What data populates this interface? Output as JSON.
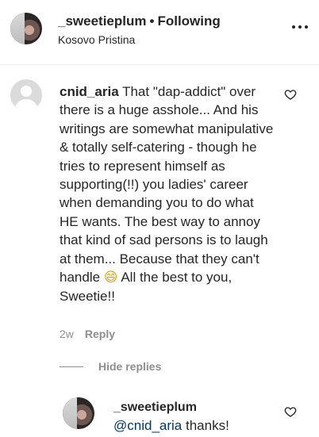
{
  "post_header": {
    "username": "_sweetieplum",
    "separator": "•",
    "follow_status": "Following",
    "location": "Kosovo Pristina"
  },
  "comment": {
    "username": "cnid_aria",
    "text_before_emoji": "That \"dap-addict\" over there is a huge asshole... And his writings are somewhat manipulative & totally self-catering - though he tries to represent himself as supporting(!!) you ladies' career when demanding you to do what HE wants. The best way to annoy that kind of sad persons is to laugh at them... Because that they can't handle",
    "emoji": "😄",
    "text_after_emoji": "All the best to you, Sweetie!!",
    "timestamp": "2w",
    "reply_label": "Reply",
    "hide_replies_label": "Hide replies"
  },
  "reply": {
    "username": "_sweetieplum",
    "mention": "@cnid_aria",
    "text": "thanks!"
  },
  "icons": {
    "more": "more-options-icon",
    "like": "heart-outline-icon"
  }
}
